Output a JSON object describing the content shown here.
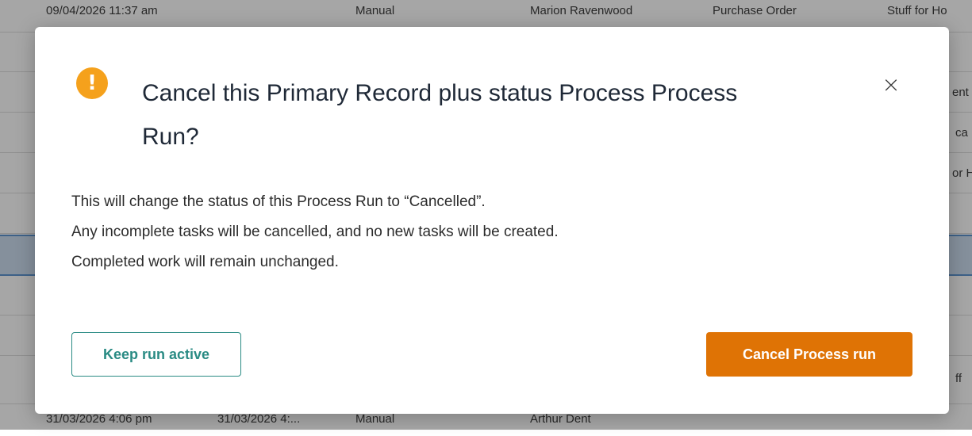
{
  "background": {
    "row_top": {
      "created": "09/04/2026 11:37 am",
      "source": "Manual",
      "user": "Marion Ravenwood",
      "type": "Purchase Order",
      "name": "Stuff for Ho"
    },
    "right_fragments": [
      "ent",
      "ca",
      "or H",
      "ff"
    ],
    "row_bottom": {
      "created": "31/03/2026 4:06 pm",
      "completed": "31/03/2026 4:...",
      "source": "Manual",
      "user": "Arthur Dent"
    }
  },
  "dialog": {
    "title": "Cancel this Primary Record plus status Process Process Run?",
    "close_symbol": "×",
    "warning_symbol": "!",
    "body_lines": [
      "This will change the status of this Process Run to “Cancelled”.",
      "Any incomplete tasks will be cancelled, and no new tasks will be created.",
      "Completed work will remain unchanged."
    ],
    "keep_button": "Keep run active",
    "cancel_button": "Cancel Process run",
    "colors": {
      "warning": "#f5a11c",
      "primary": "#df7305",
      "secondary": "#2a8b84"
    }
  }
}
